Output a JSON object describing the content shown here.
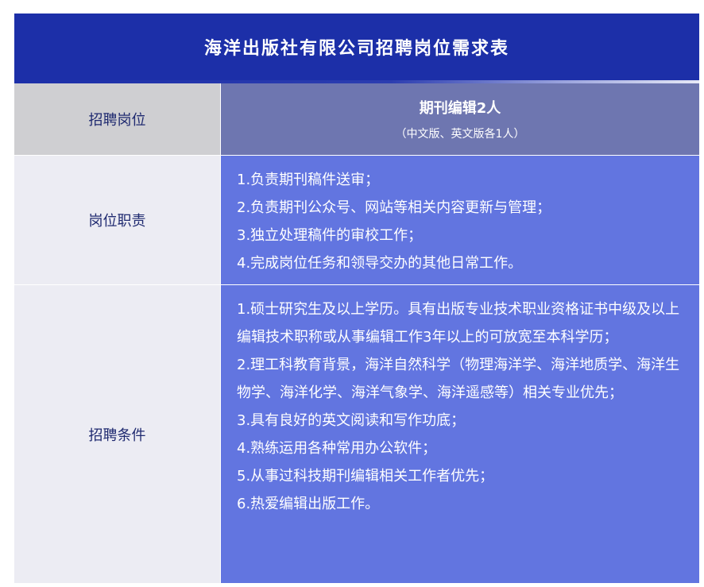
{
  "title": "海洋出版社有限公司招聘岗位需求表",
  "rows": {
    "post": {
      "label": "招聘岗位",
      "main": "期刊编辑2人",
      "sub": "（中文版、英文版各1人）"
    },
    "duties": {
      "label": "岗位职责",
      "items": [
        "1.负责期刊稿件送审；",
        "2.负责期刊公众号、网站等相关内容更新与管理；",
        "3.独立处理稿件的审校工作；",
        "4.完成岗位任务和领导交办的其他日常工作。"
      ]
    },
    "requirements": {
      "label": "招聘条件",
      "items": [
        "1.硕士研究生及以上学历。具有出版专业技术职业资格证书中级及以上编辑技术职称或从事编辑工作3年以上的可放宽至本科学历；",
        "2.理工科教育背景，海洋自然科学（物理海洋学、海洋地质学、海洋生物学、海洋化学、海洋气象学、海洋遥感等）相关专业优先；",
        "3.具有良好的英文阅读和写作功底；",
        "4.熟练运用各种常用办公软件；",
        "5.从事过科技期刊编辑相关工作者优先；",
        "6.热爱编辑出版工作。"
      ]
    }
  },
  "colors": {
    "title_bg": "#1c2fa8",
    "post_label_bg": "#cfcfd2",
    "post_content_bg": "#6e76b0",
    "label_bg": "#ececf3",
    "content_bg": "#6275e0",
    "label_text": "#1f2a70"
  }
}
